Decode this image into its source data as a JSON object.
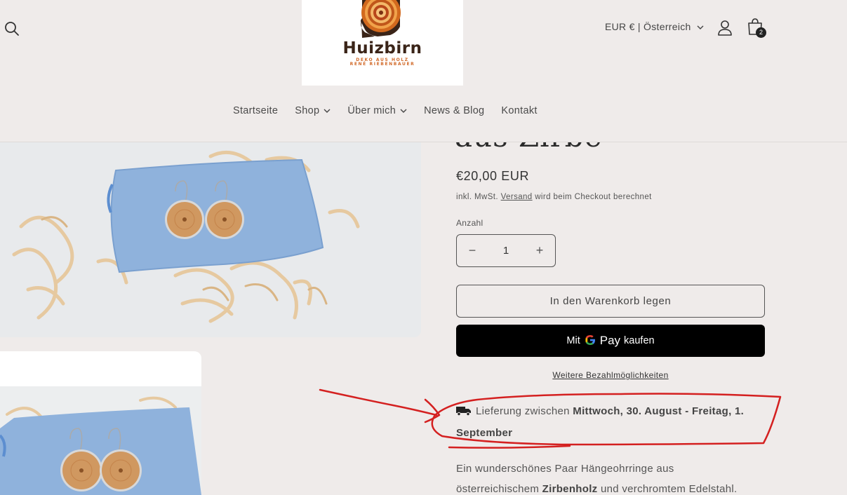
{
  "header": {
    "logo": {
      "name": "Huizbirn",
      "tagline1": "DEKO AUS HOLZ",
      "tagline2": "RENÉ RIEBENBAUER"
    },
    "currency_selector": "EUR € | Österreich",
    "cart_count": "2",
    "nav": [
      {
        "label": "Startseite",
        "has_dropdown": false
      },
      {
        "label": "Shop",
        "has_dropdown": true
      },
      {
        "label": "Über mich",
        "has_dropdown": true
      },
      {
        "label": "News & Blog",
        "has_dropdown": false
      },
      {
        "label": "Kontakt",
        "has_dropdown": false
      }
    ],
    "icons": [
      "search-icon",
      "account-icon",
      "cart-icon",
      "chevron-down-icon"
    ]
  },
  "product": {
    "title_partial": "aus Zirbe",
    "price": "€20,00 EUR",
    "tax_prefix": "inkl. MwSt.",
    "tax_link": "Versand",
    "tax_suffix": "wird beim Checkout berechnet",
    "quantity_label": "Anzahl",
    "quantity_value": "1",
    "decrease_symbol": "−",
    "increase_symbol": "+",
    "add_to_cart": "In den Warenkorb legen",
    "gpay_prefix": "Mit",
    "gpay_g": "G",
    "gpay_pay": "Pay",
    "gpay_suffix": "kaufen",
    "more_payment": "Weitere Bezahlmöglichkeiten",
    "delivery_prefix": "Lieferung zwischen",
    "delivery_dates": "Mittwoch, 30. August - Freitag, 1. September",
    "description_1": "Ein wunderschönes Paar Hängeohrringe aus",
    "description_2_prefix": "österreichischem",
    "description_2_bold": "Zirbenholz",
    "description_2_suffix": "und verchromtem Edelstahl."
  },
  "colors": {
    "background": "#efebea",
    "annotation": "#d42020",
    "button_dark": "#000000",
    "logo_orange": "#d26a2a"
  }
}
